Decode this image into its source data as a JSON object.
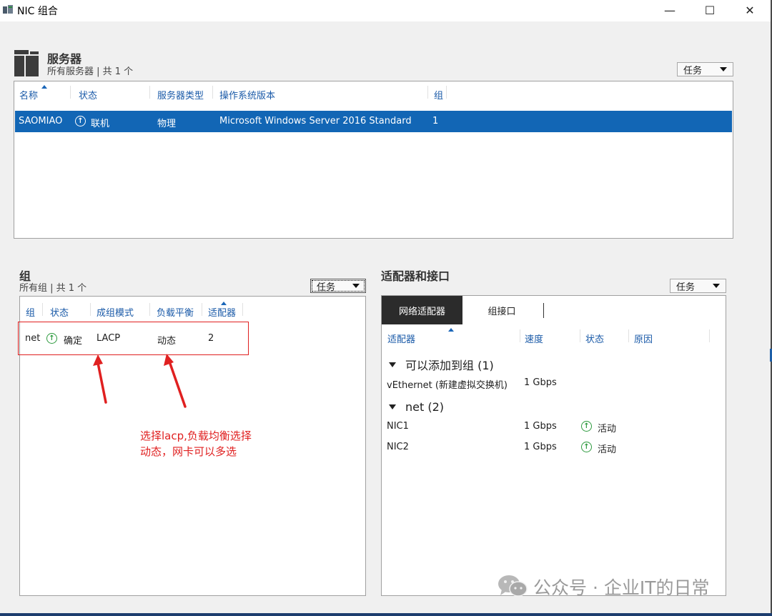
{
  "window": {
    "title": "NIC 组合",
    "minimize_glyph": "—",
    "maximize_glyph": "☐",
    "close_glyph": "✕"
  },
  "servers": {
    "title": "服务器",
    "subtitle": "所有服务器 | 共 1 个",
    "task_label": "任务",
    "columns": [
      "名称",
      "状态",
      "服务器类型",
      "操作系统版本",
      "组"
    ],
    "rows": [
      {
        "name": "SAOMIAO",
        "status": "联机",
        "type": "物理",
        "os": "Microsoft Windows Server 2016 Standard",
        "teams": "1",
        "selected": true
      }
    ]
  },
  "teams": {
    "title": "组",
    "subtitle": "所有组 | 共 1 个",
    "task_label": "任务",
    "columns": [
      "组",
      "状态",
      "成组模式",
      "负载平衡",
      "适配器"
    ],
    "rows": [
      {
        "team": "net",
        "status": "确定",
        "mode": "LACP",
        "lb": "动态",
        "adapters": "2"
      }
    ]
  },
  "adapters": {
    "title": "适配器和接口",
    "task_label": "任务",
    "tabs": [
      "网络适配器",
      "组接口"
    ],
    "active_tab": "网络适配器",
    "columns": [
      "适配器",
      "速度",
      "状态",
      "原因"
    ],
    "groups": [
      {
        "label": "可以添加到组 (1)",
        "items": [
          {
            "name": "vEthernet (新建虚拟交换机)",
            "speed": "1 Gbps",
            "state": ""
          }
        ]
      },
      {
        "label": "net (2)",
        "items": [
          {
            "name": "NIC1",
            "speed": "1 Gbps",
            "state": "活动"
          },
          {
            "name": "NIC2",
            "speed": "1 Gbps",
            "state": "活动"
          }
        ]
      }
    ]
  },
  "annotation": {
    "line1": "选择lacp,负载均衡选择",
    "line2": "动态，网卡可以多选",
    "color": "#e02020"
  },
  "watermark": {
    "text": "公众号 · 企业IT的日常"
  },
  "colors": {
    "selection": "#1266b5",
    "header_text": "#1a5aa8",
    "status_green": "#2d9a3e"
  }
}
